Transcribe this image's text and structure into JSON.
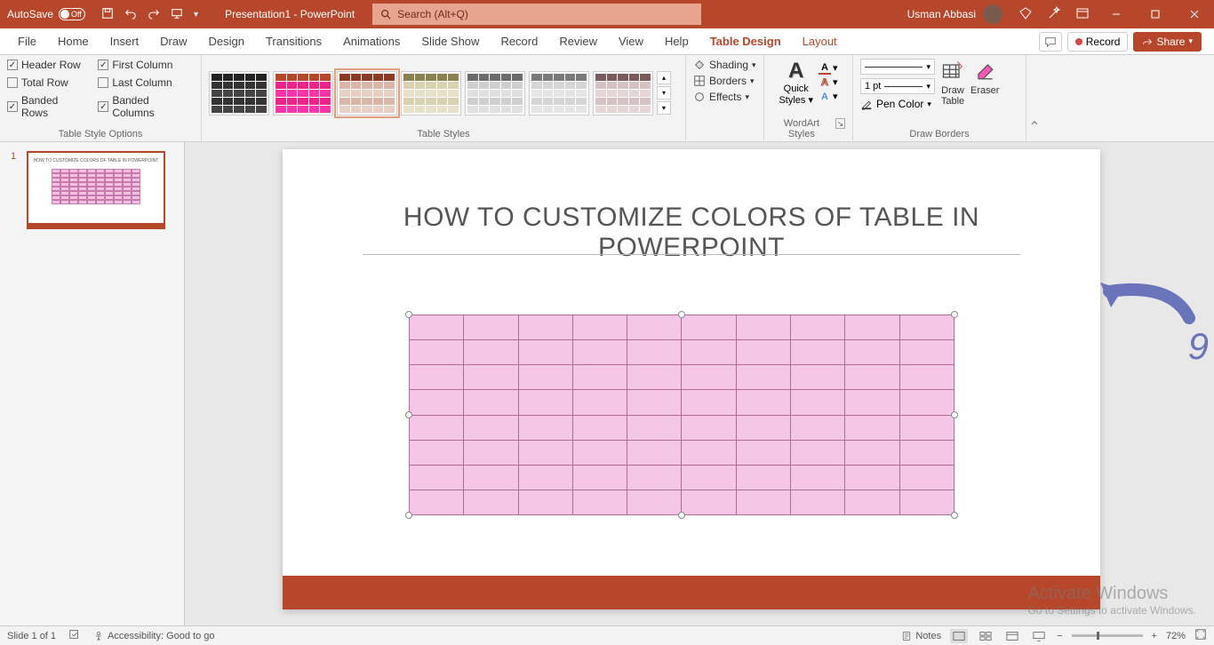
{
  "titlebar": {
    "autosave_label": "AutoSave",
    "autosave_state": "Off",
    "doc_title": "Presentation1 - PowerPoint",
    "search_placeholder": "Search (Alt+Q)",
    "user_name": "Usman Abbasi"
  },
  "tabs": {
    "items": [
      "File",
      "Home",
      "Insert",
      "Draw",
      "Design",
      "Transitions",
      "Animations",
      "Slide Show",
      "Record",
      "Review",
      "View",
      "Help",
      "Table Design",
      "Layout"
    ],
    "active": "Table Design",
    "record_label": "Record",
    "share_label": "Share"
  },
  "ribbon": {
    "tso": {
      "label": "Table Style Options",
      "header_row": "Header Row",
      "total_row": "Total Row",
      "banded_rows": "Banded Rows",
      "first_column": "First Column",
      "last_column": "Last Column",
      "banded_columns": "Banded Columns",
      "checked": {
        "header_row": true,
        "total_row": false,
        "banded_rows": true,
        "first_column": true,
        "last_column": false,
        "banded_columns": true
      }
    },
    "table_styles": {
      "label": "Table Styles"
    },
    "sbe": {
      "shading": "Shading",
      "borders": "Borders",
      "effects": "Effects"
    },
    "wordart": {
      "label": "WordArt Styles",
      "quick": "Quick",
      "styles": "Styles"
    },
    "draw_borders": {
      "label": "Draw Borders",
      "weight": "1 pt",
      "pen_color": "Pen Color",
      "draw_table": "Draw\nTable",
      "eraser": "Eraser"
    }
  },
  "slide": {
    "number": "1",
    "title": "HOW TO CUSTOMIZE COLORS OF TABLE IN POWERPOINT",
    "annotation": "9",
    "table": {
      "rows": 8,
      "cols": 10,
      "fill": "#f6c6e6",
      "border": "#b36a94"
    }
  },
  "watermark": {
    "line1": "Activate Windows",
    "line2": "Go to Settings to activate Windows."
  },
  "status": {
    "slide_info": "Slide 1 of 1",
    "accessibility": "Accessibility: Good to go",
    "notes": "Notes",
    "zoom": "72%"
  }
}
